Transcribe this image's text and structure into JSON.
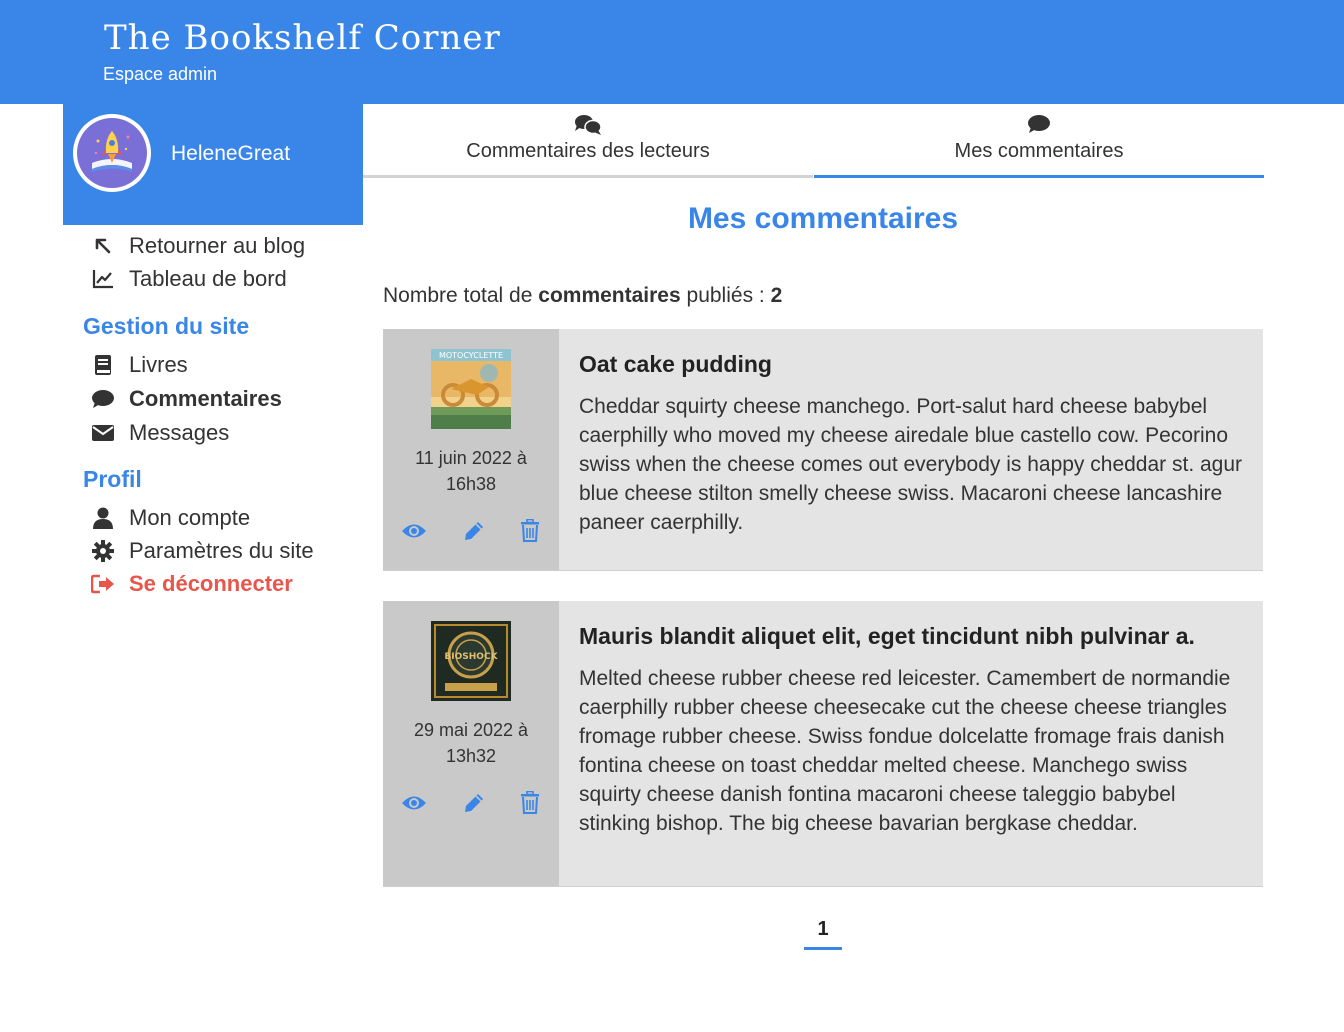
{
  "header": {
    "title": "The Bookshelf Corner",
    "subtitle": "Espace admin"
  },
  "profile": {
    "username": "HeleneGreat"
  },
  "nav": {
    "back": "Retourner au blog",
    "dashboard": "Tableau de bord",
    "section_site": "Gestion du site",
    "books": "Livres",
    "comments": "Commentaires",
    "messages": "Messages",
    "section_profile": "Profil",
    "account": "Mon compte",
    "settings": "Paramètres du site",
    "logout": "Se déconnecter"
  },
  "tabs": [
    {
      "label": "Commentaires des lecteurs",
      "icon": "comments-icon"
    },
    {
      "label": "Mes commentaires",
      "icon": "comment-icon",
      "active": true
    }
  ],
  "main": {
    "title": "Mes commentaires",
    "total_prefix": "Nombre total de",
    "total_bold": "commentaires",
    "total_suffix": "publiés :",
    "total_count": "2"
  },
  "comments": [
    {
      "date_line1": "11 juin 2022 à",
      "date_line2": "16h38",
      "title": "Oat cake pudding",
      "text": "Cheddar squirty cheese manchego. Port-salut hard cheese babybel caerphilly who moved my cheese airedale blue castello cow. Pecorino swiss when the cheese comes out everybody is happy cheddar st. agur blue cheese stilton smelly cheese swiss. Macaroni cheese lancashire paneer caerphilly.",
      "cover_text": "MOTOCYCLETTE"
    },
    {
      "date_line1": "29 mai 2022 à",
      "date_line2": "13h32",
      "title": "Mauris blandit aliquet elit, eget tincidunt nibh pulvinar a.",
      "text": "Melted cheese rubber cheese red leicester. Camembert de normandie caerphilly rubber cheese cheesecake cut the cheese cheese triangles fromage rubber cheese. Swiss fondue dolcelatte fromage frais danish fontina cheese on toast cheddar melted cheese. Manchego swiss squirty cheese danish fontina macaroni cheese taleggio babybel stinking bishop. The big cheese bavarian bergkase cheddar.",
      "cover_text": "BIOSHOCK"
    }
  ],
  "pagination": {
    "current": "1"
  },
  "colors": {
    "accent": "#3a86e8",
    "logout": "#e8554a",
    "card_bg": "#e4e4e4",
    "card_side": "#c9c9c9"
  }
}
